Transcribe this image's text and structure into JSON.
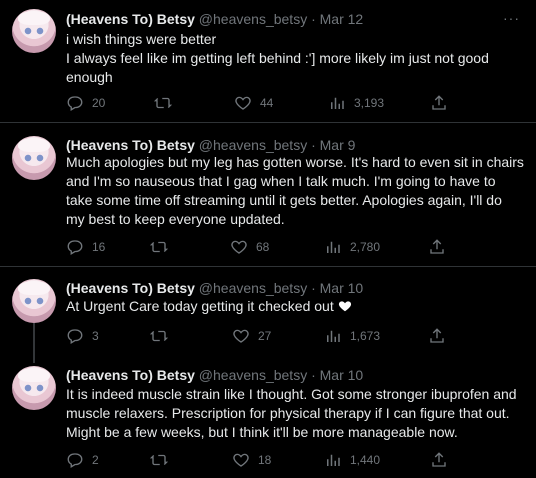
{
  "more_label": "···",
  "tweets": [
    {
      "name": "(Heavens To) Betsy",
      "handle": "@heavens_betsy",
      "dot": "·",
      "date": "Mar 12",
      "lines": [
        "i wish things were better",
        "I always feel like im getting left behind :'] more likely im just not good enough"
      ],
      "reply": "20",
      "retweet": "",
      "like": "44",
      "views": "3,193"
    },
    {
      "name": "(Heavens To) Betsy",
      "handle": "@heavens_betsy",
      "dot": "·",
      "date": "Mar 9",
      "lines": [
        "Much apologies but my leg has gotten worse. It's hard to even sit in chairs and I'm so nauseous that I gag when I talk much. I'm going to have to take some time off streaming until it gets better. Apologies again, I'll do my best to keep everyone updated."
      ],
      "reply": "16",
      "retweet": "",
      "like": "68",
      "views": "2,780"
    },
    {
      "name": "(Heavens To) Betsy",
      "handle": "@heavens_betsy",
      "dot": "·",
      "date": "Mar 10",
      "lines": [
        "At Urgent Care today getting it checked out"
      ],
      "emoji": "white-heart",
      "reply": "3",
      "retweet": "",
      "like": "27",
      "views": "1,673"
    },
    {
      "name": "(Heavens To) Betsy",
      "handle": "@heavens_betsy",
      "dot": "·",
      "date": "Mar 10",
      "lines": [
        "It is indeed muscle strain like I thought. Got some stronger ibuprofen and muscle relaxers. Prescription for physical therapy if I can figure that out. Might be a few weeks, but I think it'll be more manageable now."
      ],
      "reply": "2",
      "retweet": "",
      "like": "18",
      "views": "1,440"
    }
  ]
}
